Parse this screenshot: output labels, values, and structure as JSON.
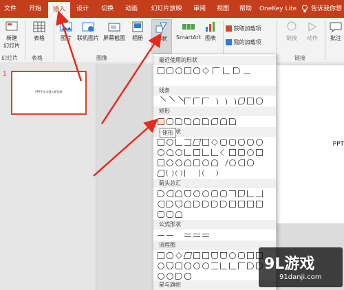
{
  "menu": {
    "tabs": [
      {
        "label": "文件"
      },
      {
        "label": "开始"
      },
      {
        "label": "插入"
      },
      {
        "label": "设计"
      },
      {
        "label": "切换"
      },
      {
        "label": "动画"
      },
      {
        "label": "幻灯片放映"
      },
      {
        "label": "审阅"
      },
      {
        "label": "视图"
      },
      {
        "label": "帮助"
      },
      {
        "label": "OneKey Lite"
      }
    ],
    "tell_me": "告诉我你想",
    "active_tab": "插入"
  },
  "ribbon": {
    "new_slide": "新建\n幻灯片",
    "table": "表格",
    "picture": "图片",
    "online_picture": "联机图片",
    "screenshot": "屏幕截图",
    "album": "相册",
    "shapes": "形状",
    "smartart": "SmartArt",
    "chart": "图表",
    "get_addins": "获取加载项",
    "my_addins": "我的加载项",
    "link": "链接",
    "action": "动作",
    "comment": "批注",
    "group_slides": "幻灯片",
    "group_tables": "表格",
    "group_images": "图像",
    "group_links": "链接"
  },
  "thumbnails": {
    "slide_number": "1",
    "slide_text": "PPT中文字插入矩形框"
  },
  "slide": {
    "visible_fragment": "PPT"
  },
  "gallery": {
    "sections": [
      {
        "title": "最近使用的形状"
      },
      {
        "title": "线条"
      },
      {
        "title": "矩形"
      },
      {
        "title": "基本形状"
      },
      {
        "title": "箭头总汇"
      },
      {
        "title": "公式形状"
      },
      {
        "title": "流程图"
      },
      {
        "title": "星与旗帜"
      }
    ],
    "tooltip": "矩形"
  },
  "watermark": {
    "logo": "9L游戏",
    "url": "91danji.com"
  },
  "colors": {
    "accent": "#c43e1c",
    "thumb_border": "#d24726",
    "arrow": "#e8291c"
  },
  "icons": [
    "new-slide-icon",
    "table-icon",
    "picture-icon",
    "online-picture-icon",
    "screenshot-icon",
    "album-icon",
    "shapes-icon",
    "smartart-icon",
    "chart-icon",
    "store-icon",
    "addins-icon",
    "link-icon",
    "action-icon",
    "comment-icon",
    "lightbulb-icon"
  ]
}
